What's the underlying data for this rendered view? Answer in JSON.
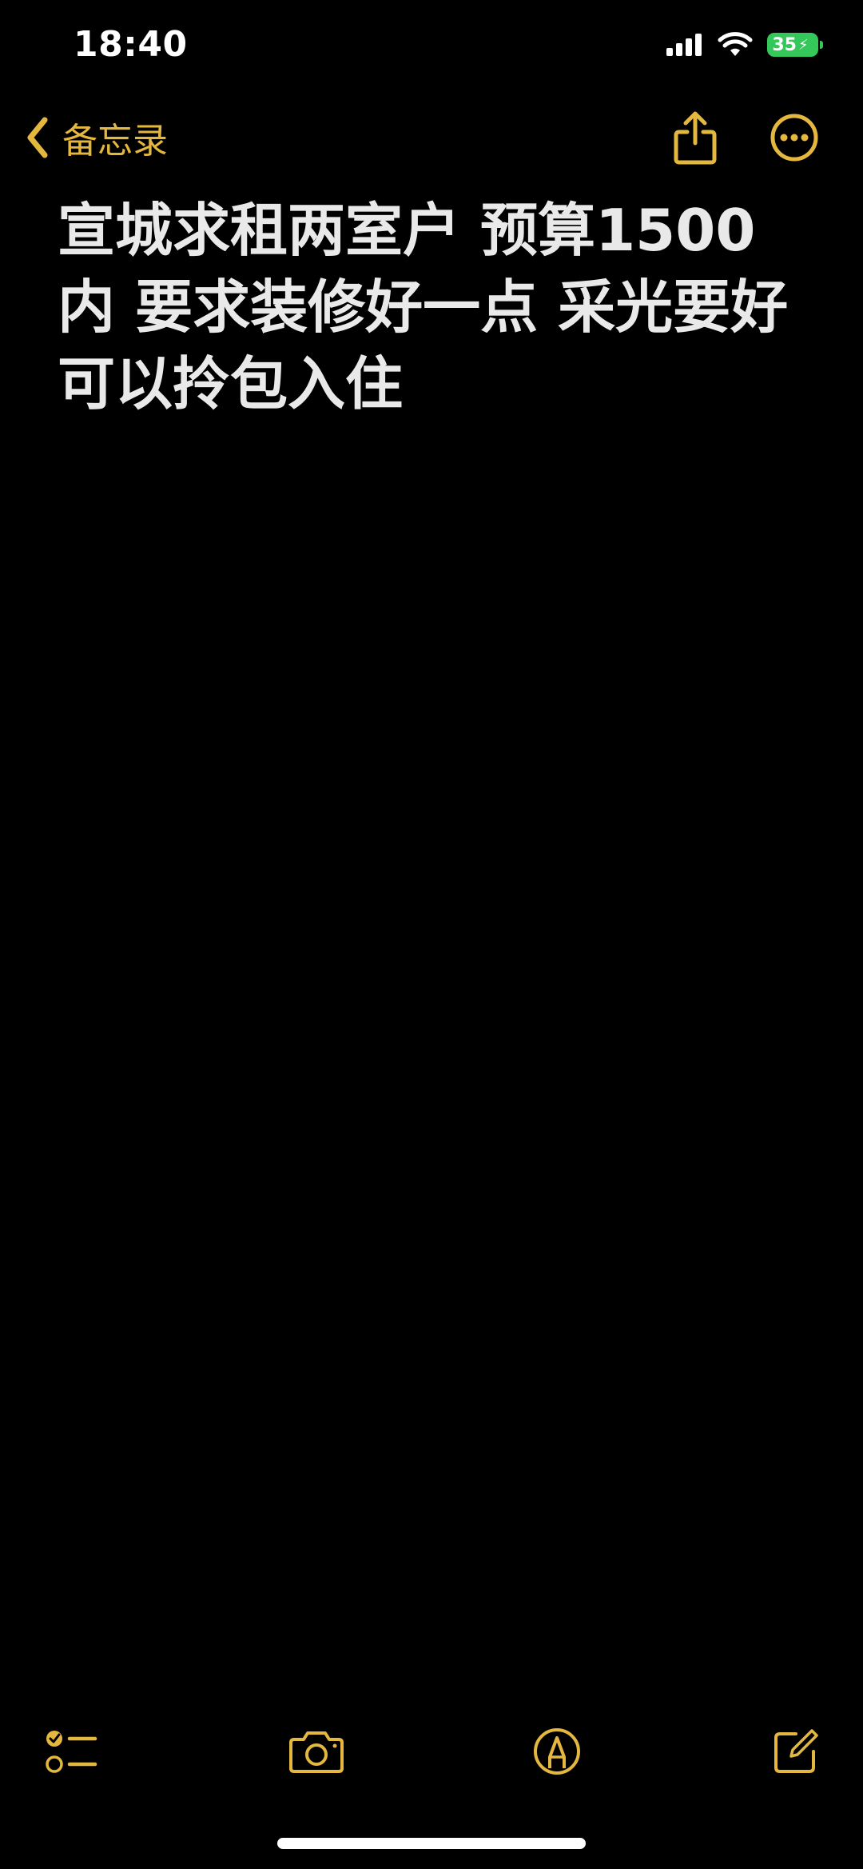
{
  "status_bar": {
    "time": "18:40",
    "battery_level": "35",
    "icons": [
      "signal-icon",
      "wifi-icon",
      "battery-icon",
      "charging-bolt-icon"
    ]
  },
  "nav": {
    "back_label": "备忘录",
    "icons": [
      "chevron-left-icon",
      "share-icon",
      "more-icon"
    ]
  },
  "note": {
    "text": "宣城求租两室户 预算1500内 要求装修好一点 采光要好可以拎包入住"
  },
  "toolbar": {
    "icons": [
      "checklist-icon",
      "camera-icon",
      "markup-icon",
      "compose-icon"
    ]
  },
  "colors": {
    "accent": "#e4b73f",
    "background": "#000000",
    "text": "#e9e9e9",
    "battery": "#34c759"
  }
}
